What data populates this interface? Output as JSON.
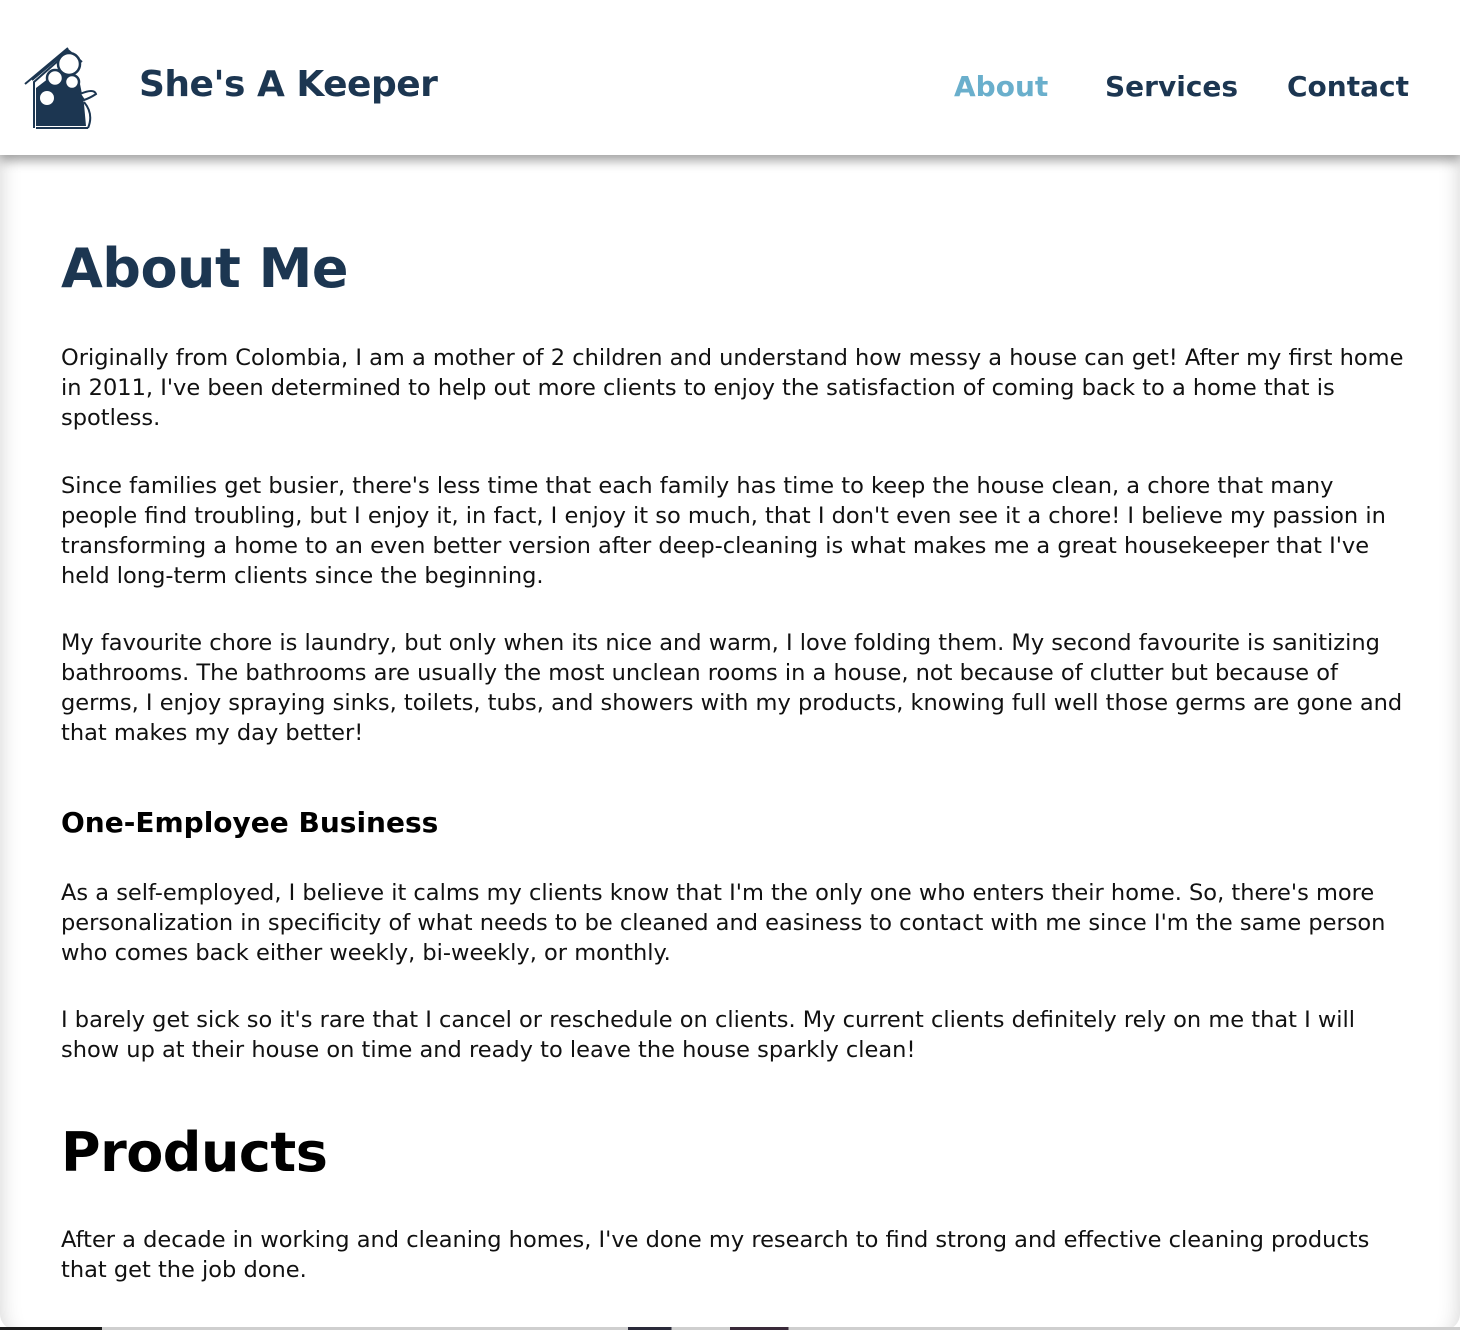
{
  "header": {
    "brand": "She's A Keeper",
    "logo_icon": "house-cleaner-logo-icon",
    "nav": [
      {
        "label": "About",
        "active": true
      },
      {
        "label": "Services",
        "active": false
      },
      {
        "label": "Contact",
        "active": false
      }
    ]
  },
  "about": {
    "title": "About Me",
    "paragraphs": [
      "Originally from Colombia, I am a mother of 2 children and understand how messy a house can get! After my first home in 2011, I've been determined to help out more clients to enjoy the satisfaction of coming back to a home that is spotless.",
      "Since families get busier, there's less time that each family has time to keep the house clean, a chore that many people find troubling, but I enjoy it, in fact, I enjoy it so much, that I don't even see it a chore! I believe my passion in transforming a home to an even better version after deep-cleaning is what makes me a great housekeeper that I've held long-term clients since the beginning.",
      "My favourite chore is laundry, but only when its nice and warm, I love folding them. My second favourite is sanitizing bathrooms. The bathrooms are usually the most unclean rooms in a house, not because of clutter but because of germs, I enjoy spraying sinks, toilets, tubs, and showers with my products, knowing full well those germs are gone and that makes my day better!"
    ]
  },
  "business": {
    "title": "One-Employee Business",
    "paragraphs": [
      "As a self-employed, I believe it calms my clients know that I'm the only one who enters their home. So, there's more personalization in specificity of what needs to be cleaned and easiness to contact with me since I'm the same person who comes back either weekly, bi-weekly, or monthly.",
      "I barely get sick so it's rare that I cancel or reschedule on clients. My current clients definitely rely on me that I will show up at their house on time and ready to leave the house sparkly clean!"
    ]
  },
  "products": {
    "title": "Products",
    "paragraphs": [
      "After a decade in working and cleaning homes, I've done my research to find strong and effective cleaning products that get the job done."
    ]
  },
  "colors": {
    "brand_navy": "#1c3651",
    "nav_active": "#6aafcc",
    "text": "#111111"
  }
}
